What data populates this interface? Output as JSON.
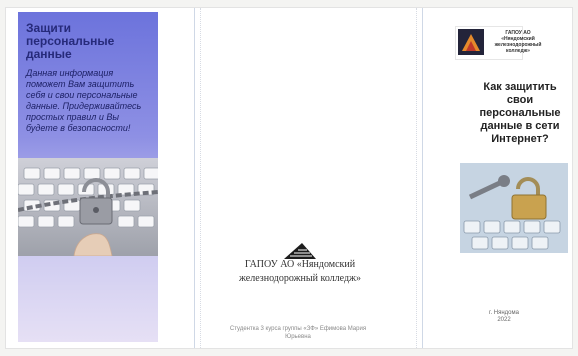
{
  "left": {
    "title": "Защити персональные данные",
    "text": "Данная информация поможет Вам защитить себя и свои персональные данные. Придерживайтесь простых правил и Вы будете в безопасности!"
  },
  "middle": {
    "college_name": "ГАПОУ АО «Няндомский железнодорожный колледж»",
    "student": "Студентка 3 курса группы «ЗФ» Ефимова Мария Юрьевна"
  },
  "right": {
    "org": "ГАПОУ АО «Няндомский железнодорожный колледж»",
    "title": "Как защитить свои персональные данные в сети Интернет?",
    "city": "г. Няндома",
    "year": "2022"
  }
}
